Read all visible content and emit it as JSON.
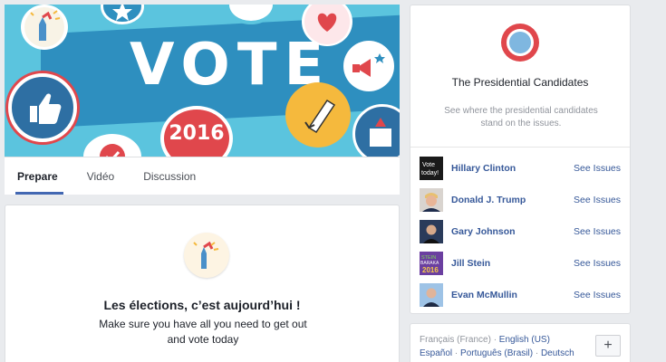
{
  "banner": {
    "title": "VOTE",
    "year": "2016"
  },
  "tabs": [
    {
      "label": "Prepare",
      "active": true
    },
    {
      "label": "Vidéo",
      "active": false
    },
    {
      "label": "Discussion",
      "active": false
    }
  ],
  "election_card": {
    "heading": "Les élections, c’est aujourd’hui !",
    "line1": "Make sure you have all you need to get out",
    "line2": "and vote today"
  },
  "candidates_panel": {
    "title": "The Presidential Candidates",
    "subtitle_line1": "See where the presidential candidates",
    "subtitle_line2": "stand on the issues.",
    "candidates": [
      {
        "name": "Hillary Clinton",
        "link": "See Issues",
        "photo_text": "Vote today"
      },
      {
        "name": "Donald J. Trump",
        "link": "See Issues"
      },
      {
        "name": "Gary Johnson",
        "link": "See Issues"
      },
      {
        "name": "Jill Stein",
        "link": "See Issues",
        "photo_text": "STEIN BARAKA 2016"
      },
      {
        "name": "Evan McMullin",
        "link": "See Issues"
      }
    ]
  },
  "languages": {
    "current": "Français (France)",
    "items_row1": [
      "English (US)"
    ],
    "items_row2": [
      "Español",
      "Português (Brasil)",
      "Deutsch"
    ],
    "more_label": "+"
  }
}
